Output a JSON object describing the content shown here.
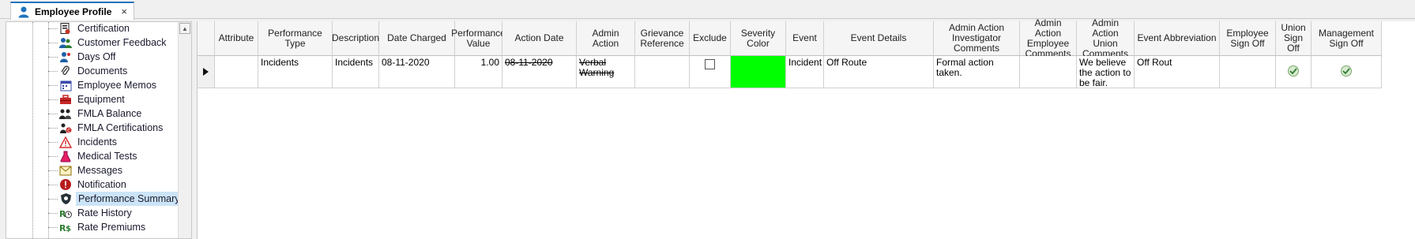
{
  "tab": {
    "title": "Employee Profile",
    "close": "×"
  },
  "tree": {
    "items": [
      {
        "label": "Certification",
        "icon": "certification-icon"
      },
      {
        "label": "Customer Feedback",
        "icon": "people-icon"
      },
      {
        "label": "Days Off",
        "icon": "days-off-icon"
      },
      {
        "label": "Documents",
        "icon": "paperclip-icon"
      },
      {
        "label": "Employee Memos",
        "icon": "calendar-icon"
      },
      {
        "label": "Equipment",
        "icon": "toolbox-icon"
      },
      {
        "label": "FMLA Balance",
        "icon": "family-icon"
      },
      {
        "label": "FMLA Certifications",
        "icon": "family-cert-icon"
      },
      {
        "label": "Incidents",
        "icon": "warning-icon"
      },
      {
        "label": "Medical Tests",
        "icon": "flask-icon"
      },
      {
        "label": "Messages",
        "icon": "envelope-icon"
      },
      {
        "label": "Notification",
        "icon": "alert-icon"
      },
      {
        "label": "Performance Summary",
        "icon": "shield-icon",
        "selected": true
      },
      {
        "label": "Rate History",
        "icon": "rate-history-icon"
      },
      {
        "label": "Rate Premiums",
        "icon": "rate-premium-icon"
      }
    ]
  },
  "grid": {
    "headers": [
      "Attribute",
      "Performance Type",
      "Description",
      "Date Charged",
      "Performance Value",
      "Action Date",
      "Admin Action",
      "Grievance Reference",
      "Exclude",
      "Severity Color",
      "Event",
      "Event Details",
      "Admin Action Investigator Comments",
      "Admin Action Employee Comments",
      "Admin Action Union Comments",
      "Event Abbreviation",
      "Employee Sign Off",
      "Union Sign Off",
      "Management Sign Off"
    ],
    "row": {
      "attribute": "",
      "performance_type": "Incidents",
      "description": "Incidents",
      "date_charged": "08-11-2020",
      "performance_value": "1.00",
      "action_date": "08-11-2020",
      "admin_action": "Verbal Warning",
      "grievance_reference": "",
      "exclude": false,
      "severity_color": "#00ff00",
      "event": "Incident",
      "event_details": "Off Route",
      "investigator_comments": "Formal action taken.",
      "employee_comments": "",
      "union_comments": "We believe the action to be fair.",
      "event_abbreviation": "Off Rout",
      "employee_sign_off": "",
      "union_sign_off": true,
      "management_sign_off": true
    }
  },
  "colors": {
    "accent": "#1e73be",
    "selected_bg": "#cce4f7",
    "severity": "#00ff00"
  }
}
